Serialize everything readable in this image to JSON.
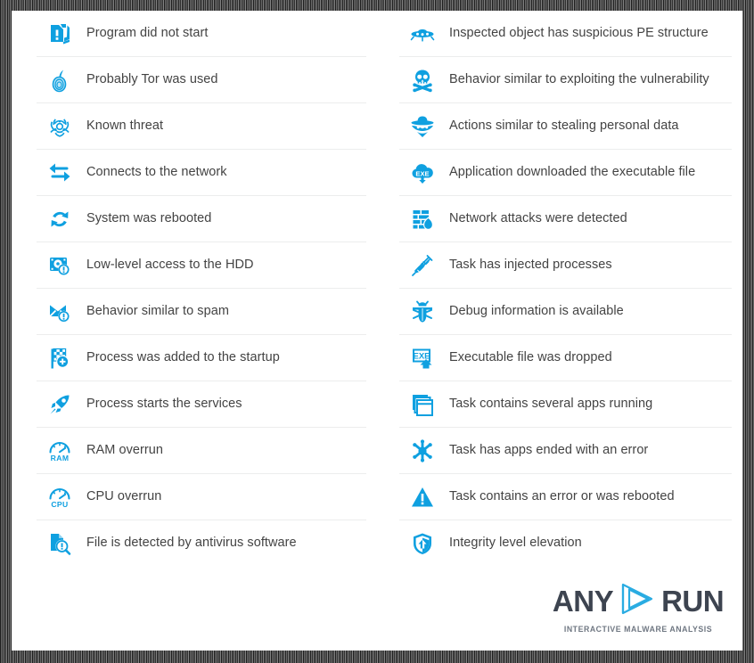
{
  "colors": {
    "accent_blue": "#0fa0e0",
    "text_gray": "#434343",
    "separator": "#eceded",
    "logo_dark": "#3d4450",
    "logo_sub_gray": "#6f7782",
    "page_background": "#ffffff",
    "frame_dark": "#3a3a3a"
  },
  "legend": {
    "left_column": [
      {
        "icon": "file-exclamation-icon",
        "label": "Program did not start"
      },
      {
        "icon": "tor-onion-icon",
        "label": "Probably Tor was used"
      },
      {
        "icon": "biohazard-icon",
        "label": "Known threat"
      },
      {
        "icon": "network-arrows-icon",
        "label": "Connects to the network"
      },
      {
        "icon": "reboot-refresh-icon",
        "label": "System was rebooted"
      },
      {
        "icon": "hdd-exclamation-icon",
        "label": "Low-level access to the HDD"
      },
      {
        "icon": "envelope-exclamation-icon",
        "label": "Behavior similar to spam"
      },
      {
        "icon": "checkered-flag-plus-icon",
        "label": "Process was added to the startup"
      },
      {
        "icon": "rocket-icon",
        "label": "Process starts the services"
      },
      {
        "icon": "gauge-ram-icon",
        "label": "RAM overrun"
      },
      {
        "icon": "gauge-cpu-icon",
        "label": "CPU overrun"
      },
      {
        "icon": "file-magnifier-exclamation-icon",
        "label": "File is detected by antivirus software"
      }
    ],
    "right_column": [
      {
        "icon": "ufo-icon",
        "label": "Inspected object has suspicious PE structure"
      },
      {
        "icon": "skull-crossbones-icon",
        "label": "Behavior similar to exploiting the vulnerability"
      },
      {
        "icon": "spy-hat-icon",
        "label": "Actions similar to stealing personal data"
      },
      {
        "icon": "cloud-exe-download-icon",
        "label": "Application downloaded the executable file"
      },
      {
        "icon": "firewall-flame-icon",
        "label": "Network attacks were detected"
      },
      {
        "icon": "syringe-icon",
        "label": "Task has injected processes"
      },
      {
        "icon": "bug-icon",
        "label": "Debug information is available"
      },
      {
        "icon": "exe-dropped-icon",
        "label": "Executable file was dropped"
      },
      {
        "icon": "windows-stack-icon",
        "label": "Task contains several apps running"
      },
      {
        "icon": "error-burst-icon",
        "label": "Task has apps ended with an error"
      },
      {
        "icon": "warning-triangle-icon",
        "label": "Task contains an error or was rebooted"
      },
      {
        "icon": "shield-up-arrow-icon",
        "label": "Integrity level elevation"
      }
    ]
  },
  "logo": {
    "word_left": "ANY",
    "word_right": "RUN",
    "mark": "play-triangle-icon",
    "tagline": "INTERACTIVE MALWARE ANALYSIS"
  }
}
